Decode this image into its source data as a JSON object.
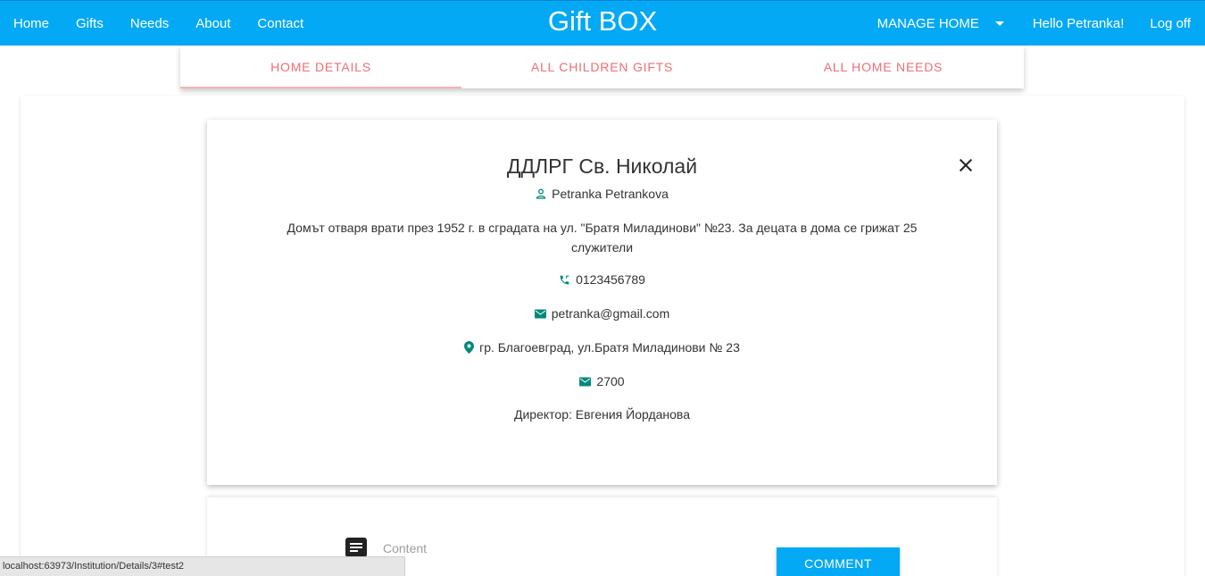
{
  "nav": {
    "left_links": [
      "Home",
      "Gifts",
      "Needs",
      "About",
      "Contact"
    ],
    "brand": "Gift BOX",
    "manage": "MANAGE HOME",
    "hello": "Hello Petranka!",
    "logoff": "Log off"
  },
  "tabs": [
    "HOME DETAILS",
    "ALL CHILDREN GIFTS",
    "ALL HOME NEEDS"
  ],
  "details": {
    "title": "ДДЛРГ Св. Николай",
    "person": "Petranka Petrankova",
    "description": "Домът отваря врати през 1952 г. в сградата на ул. \"Братя Миладинови\" №23. За децата в дома се грижат 25 служители",
    "phone": "0123456789",
    "email": "petranka@gmail.com",
    "address": "гр. Благоевград, ул.Братя Миладинови № 23",
    "postcode": "2700",
    "director": "Директор: Евгения Йорданова"
  },
  "comment": {
    "placeholder": "Content",
    "button": "COMMENT"
  },
  "status_url": "localhost:63973/Institution/Details/3#test2",
  "colors": {
    "primary": "#03a9f4",
    "tab_text": "#ee6e73",
    "icon_teal": "#00897b"
  }
}
